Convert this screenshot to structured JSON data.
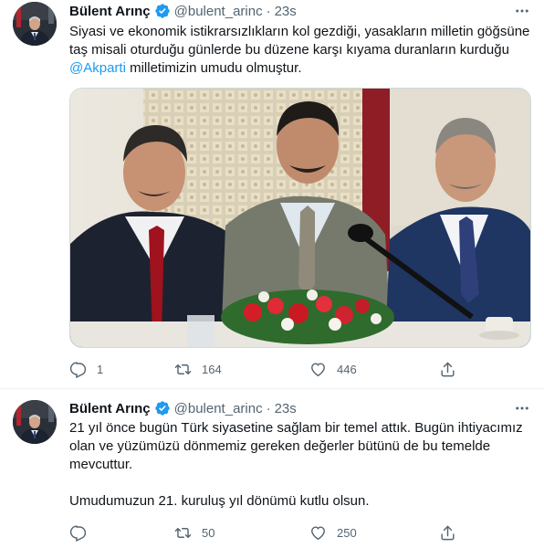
{
  "tweets": [
    {
      "author": {
        "name": "Bülent Arınç",
        "handle": "@bulent_arinc",
        "verified": true,
        "avatar_icon": "profile-photo"
      },
      "time": "23s",
      "separator": "·",
      "text_lines": [
        "Siyasi ve ekonomik istikrarsızlıkların kol gezdiği, yasakların milletin göğsüne",
        "taş misali oturduğu günlerde bu düzene karşı kıyama duranların kurduğu"
      ],
      "mention": "@Akparti",
      "text_after_mention": " milletimizin umudu olmuştur.",
      "media": {
        "type": "photo"
      },
      "stats": {
        "replies": "1",
        "retweets": "164",
        "likes": "446"
      }
    },
    {
      "author": {
        "name": "Bülent Arınç",
        "handle": "@bulent_arinc",
        "verified": true,
        "avatar_icon": "profile-photo"
      },
      "time": "23s",
      "separator": "·",
      "paragraph1_lines": [
        "21 yıl önce bugün Türk siyasetine sağlam bir temel attık. Bugün ihtiyacımız",
        "olan ve yüzümüzü dönmemiz gereken değerler bütünü de bu temelde",
        "mevcuttur."
      ],
      "paragraph2": "Umudumuzun 21. kuruluş yıl dönümü kutlu olsun.",
      "stats": {
        "replies": "",
        "retweets": "50",
        "likes": "250"
      }
    }
  ],
  "colors": {
    "text": "#0f1419",
    "secondary": "#536471",
    "accent": "#1d9bf0",
    "divider": "#eff3f4"
  },
  "icons": [
    "more-icon",
    "verified-badge-icon",
    "reply-icon",
    "retweet-icon",
    "like-icon",
    "share-icon"
  ]
}
